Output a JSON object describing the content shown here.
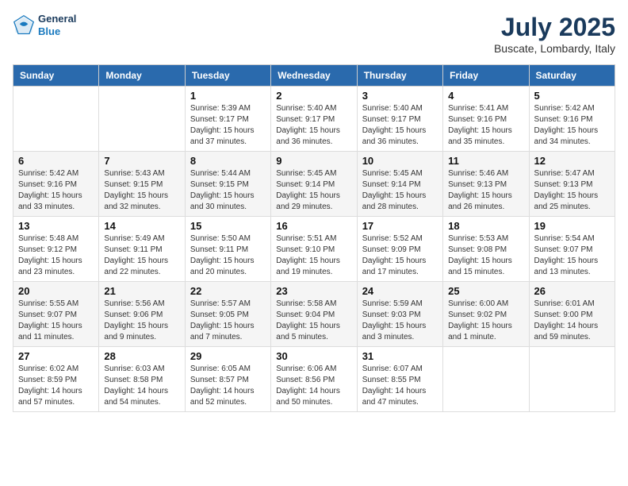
{
  "logo": {
    "general": "General",
    "blue": "Blue"
  },
  "header": {
    "month": "July 2025",
    "location": "Buscate, Lombardy, Italy"
  },
  "weekdays": [
    "Sunday",
    "Monday",
    "Tuesday",
    "Wednesday",
    "Thursday",
    "Friday",
    "Saturday"
  ],
  "weeks": [
    [
      {
        "day": "",
        "detail": ""
      },
      {
        "day": "",
        "detail": ""
      },
      {
        "day": "1",
        "detail": "Sunrise: 5:39 AM\nSunset: 9:17 PM\nDaylight: 15 hours and 37 minutes."
      },
      {
        "day": "2",
        "detail": "Sunrise: 5:40 AM\nSunset: 9:17 PM\nDaylight: 15 hours and 36 minutes."
      },
      {
        "day": "3",
        "detail": "Sunrise: 5:40 AM\nSunset: 9:17 PM\nDaylight: 15 hours and 36 minutes."
      },
      {
        "day": "4",
        "detail": "Sunrise: 5:41 AM\nSunset: 9:16 PM\nDaylight: 15 hours and 35 minutes."
      },
      {
        "day": "5",
        "detail": "Sunrise: 5:42 AM\nSunset: 9:16 PM\nDaylight: 15 hours and 34 minutes."
      }
    ],
    [
      {
        "day": "6",
        "detail": "Sunrise: 5:42 AM\nSunset: 9:16 PM\nDaylight: 15 hours and 33 minutes."
      },
      {
        "day": "7",
        "detail": "Sunrise: 5:43 AM\nSunset: 9:15 PM\nDaylight: 15 hours and 32 minutes."
      },
      {
        "day": "8",
        "detail": "Sunrise: 5:44 AM\nSunset: 9:15 PM\nDaylight: 15 hours and 30 minutes."
      },
      {
        "day": "9",
        "detail": "Sunrise: 5:45 AM\nSunset: 9:14 PM\nDaylight: 15 hours and 29 minutes."
      },
      {
        "day": "10",
        "detail": "Sunrise: 5:45 AM\nSunset: 9:14 PM\nDaylight: 15 hours and 28 minutes."
      },
      {
        "day": "11",
        "detail": "Sunrise: 5:46 AM\nSunset: 9:13 PM\nDaylight: 15 hours and 26 minutes."
      },
      {
        "day": "12",
        "detail": "Sunrise: 5:47 AM\nSunset: 9:13 PM\nDaylight: 15 hours and 25 minutes."
      }
    ],
    [
      {
        "day": "13",
        "detail": "Sunrise: 5:48 AM\nSunset: 9:12 PM\nDaylight: 15 hours and 23 minutes."
      },
      {
        "day": "14",
        "detail": "Sunrise: 5:49 AM\nSunset: 9:11 PM\nDaylight: 15 hours and 22 minutes."
      },
      {
        "day": "15",
        "detail": "Sunrise: 5:50 AM\nSunset: 9:11 PM\nDaylight: 15 hours and 20 minutes."
      },
      {
        "day": "16",
        "detail": "Sunrise: 5:51 AM\nSunset: 9:10 PM\nDaylight: 15 hours and 19 minutes."
      },
      {
        "day": "17",
        "detail": "Sunrise: 5:52 AM\nSunset: 9:09 PM\nDaylight: 15 hours and 17 minutes."
      },
      {
        "day": "18",
        "detail": "Sunrise: 5:53 AM\nSunset: 9:08 PM\nDaylight: 15 hours and 15 minutes."
      },
      {
        "day": "19",
        "detail": "Sunrise: 5:54 AM\nSunset: 9:07 PM\nDaylight: 15 hours and 13 minutes."
      }
    ],
    [
      {
        "day": "20",
        "detail": "Sunrise: 5:55 AM\nSunset: 9:07 PM\nDaylight: 15 hours and 11 minutes."
      },
      {
        "day": "21",
        "detail": "Sunrise: 5:56 AM\nSunset: 9:06 PM\nDaylight: 15 hours and 9 minutes."
      },
      {
        "day": "22",
        "detail": "Sunrise: 5:57 AM\nSunset: 9:05 PM\nDaylight: 15 hours and 7 minutes."
      },
      {
        "day": "23",
        "detail": "Sunrise: 5:58 AM\nSunset: 9:04 PM\nDaylight: 15 hours and 5 minutes."
      },
      {
        "day": "24",
        "detail": "Sunrise: 5:59 AM\nSunset: 9:03 PM\nDaylight: 15 hours and 3 minutes."
      },
      {
        "day": "25",
        "detail": "Sunrise: 6:00 AM\nSunset: 9:02 PM\nDaylight: 15 hours and 1 minute."
      },
      {
        "day": "26",
        "detail": "Sunrise: 6:01 AM\nSunset: 9:00 PM\nDaylight: 14 hours and 59 minutes."
      }
    ],
    [
      {
        "day": "27",
        "detail": "Sunrise: 6:02 AM\nSunset: 8:59 PM\nDaylight: 14 hours and 57 minutes."
      },
      {
        "day": "28",
        "detail": "Sunrise: 6:03 AM\nSunset: 8:58 PM\nDaylight: 14 hours and 54 minutes."
      },
      {
        "day": "29",
        "detail": "Sunrise: 6:05 AM\nSunset: 8:57 PM\nDaylight: 14 hours and 52 minutes."
      },
      {
        "day": "30",
        "detail": "Sunrise: 6:06 AM\nSunset: 8:56 PM\nDaylight: 14 hours and 50 minutes."
      },
      {
        "day": "31",
        "detail": "Sunrise: 6:07 AM\nSunset: 8:55 PM\nDaylight: 14 hours and 47 minutes."
      },
      {
        "day": "",
        "detail": ""
      },
      {
        "day": "",
        "detail": ""
      }
    ]
  ]
}
